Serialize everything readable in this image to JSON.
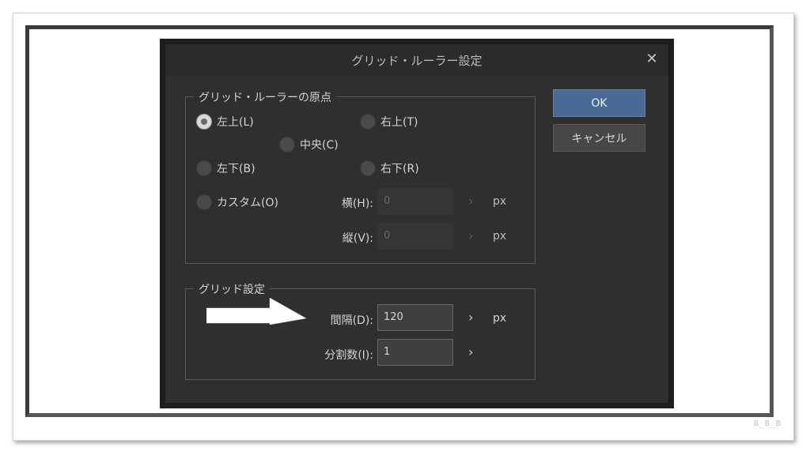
{
  "dialog": {
    "title": "グリッド・ルーラー設定",
    "close_glyph": "✕",
    "ok_label": "OK",
    "cancel_label": "キャンセル"
  },
  "origin_group": {
    "legend": "グリッド・ルーラーの原点",
    "radios": {
      "top_left": "左上(L)",
      "top_right": "右上(T)",
      "center": "中央(C)",
      "bottom_left": "左下(B)",
      "bottom_right": "右下(R)",
      "custom": "カスタム(O)"
    },
    "selected": "top_left",
    "horizontal_label": "横(H):",
    "horizontal_value": "0",
    "vertical_label": "縦(V):",
    "vertical_value": "0",
    "unit": "px"
  },
  "grid_group": {
    "legend": "グリッド設定",
    "interval_label": "間隔(D):",
    "interval_value": "120",
    "interval_unit": "px",
    "divisions_label": "分割数(I):",
    "divisions_value": "1"
  },
  "chevron_glyph": "›",
  "watermark": "B_B_B",
  "colors": {
    "dialog_bg": "#2f2f2f",
    "ok_button": "#4a6a96",
    "annotation_arrow": "#ffffff"
  },
  "icons": {
    "close": "close-icon",
    "chevron": "chevron-right-icon",
    "annotation": "arrow-right-icon"
  }
}
